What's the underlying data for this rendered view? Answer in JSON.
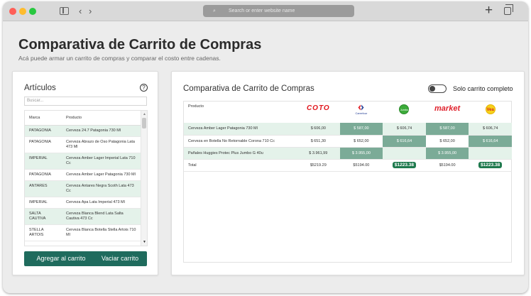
{
  "browser": {
    "url_placeholder": "Search or enter website name",
    "search_glyph": "⌕",
    "back_glyph": "‹",
    "forward_glyph": "›",
    "new_tab_glyph": "+"
  },
  "header": {
    "title": "Comparativa de Carrito de Compras",
    "subtitle": "Acá puede armar un carrito de compras y comparar el costo entre cadenas."
  },
  "articulos": {
    "title": "Artículos",
    "help_glyph": "?",
    "search_placeholder": "Buscar...",
    "columns": [
      "Marca",
      "Producto"
    ],
    "rows": [
      {
        "marca": "PATAGONIA",
        "producto": "Cerveza 24.7 Patagonia 730 Ml",
        "hl": true
      },
      {
        "marca": "PATAGONIA",
        "producto": "Cerveza Abrazo de Oso Patagonia Lata 473 Ml",
        "hl": false
      },
      {
        "marca": "IMPERIAL",
        "producto": "Cerveza Amber Lager Imperial Lata 710 Cc",
        "hl": true
      },
      {
        "marca": "PATAGONIA",
        "producto": "Cerveza Amber Lager Patagonia 730 Ml",
        "hl": false
      },
      {
        "marca": "ANTARES",
        "producto": "Cerveza Antares Negra Scoth Lata 473 Cc",
        "hl": true
      },
      {
        "marca": "IMPERIAL",
        "producto": "Cerveza Apa Lata Imperial 473 Ml",
        "hl": false
      },
      {
        "marca": "SALTA CAUTIVA",
        "producto": "Cerveza Blanca Blend Lata Salta Cautiva 473 Cc",
        "hl": true
      },
      {
        "marca": "STELLA ARTOIS",
        "producto": "Cerveza Blanca Botella Stella Artois 710 Ml",
        "hl": false
      }
    ],
    "add_button": "Agregar al carrito",
    "clear_button": "Vaciar carrito"
  },
  "comparativa": {
    "title": "Comparativa de Carrito de Compras",
    "toggle_label": "Solo carrito completo",
    "product_header": "Producto",
    "stores": [
      {
        "name": "coto",
        "logo_text": "COTO"
      },
      {
        "name": "carrefour",
        "logo_text": "Carrefour"
      },
      {
        "name": "jumbo",
        "logo_text": "Jumbo"
      },
      {
        "name": "market",
        "logo_text": "market"
      },
      {
        "name": "vea",
        "logo_text": "Vea"
      }
    ],
    "rows": [
      {
        "producto": "Cerveza Amber Lager Patagonia 730 Ml",
        "prices": [
          "$ 606,00",
          "$ 587,00",
          "$ 606,74",
          "$ 587,00",
          "$ 606,74"
        ],
        "best": [
          false,
          true,
          false,
          true,
          false
        ],
        "hl": true
      },
      {
        "producto": "Cerveza en Botella No Retornable Corona 710 Cc",
        "prices": [
          "$ 651,30",
          "$ 652,00",
          "$ 616,64",
          "$ 652,00",
          "$ 616,64"
        ],
        "best": [
          false,
          false,
          true,
          false,
          true
        ],
        "hl": false
      },
      {
        "producto": "Pañales Huggies Protec Plus Jumbo G 40u",
        "prices": [
          "$ 3.961,99",
          "$ 3.955,00",
          "",
          "$ 3.955,00",
          ""
        ],
        "best": [
          false,
          true,
          false,
          true,
          false
        ],
        "hl": true
      }
    ],
    "total_label": "Total",
    "totals": [
      "$5219.29",
      "$5194.00",
      "$1223.38",
      "$5194.00",
      "$1223.38"
    ],
    "totals_best": [
      false,
      false,
      true,
      false,
      true
    ]
  },
  "colors": {
    "accent": "#1f6b5d",
    "row_highlight": "#e4f2ea",
    "best_price": "#7bab97",
    "total_badge": "#1f7a4e"
  }
}
